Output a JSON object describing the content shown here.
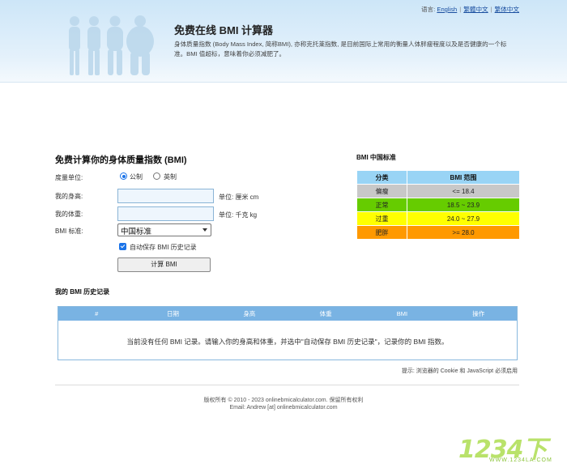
{
  "header": {
    "title": "免费在线 BMI 计算器",
    "description": "身体质量指数 (Body Mass Index, 简称BMI), 亦称克托莱指数, 是目前国际上常用的衡量人体胖瘦程度以及是否健康的一个标准。BMI 值超标，意味着你必须减肥了。",
    "lang_prefix": "语言:",
    "lang_options": [
      "English",
      "繁體中文",
      "繁体中文"
    ]
  },
  "form": {
    "title": "免费计算你的身体质量指数 (BMI)",
    "unit_label": "度量单位:",
    "unit_options": [
      "公制",
      "英制"
    ],
    "unit_selected": "公制",
    "height_label": "我的身高:",
    "height_value": "",
    "height_unit": "单位: 厘米 cm",
    "weight_label": "我的体重:",
    "weight_value": "",
    "weight_unit": "单位: 千克 kg",
    "standard_label": "BMI 标准:",
    "standard_selected": "中国标准",
    "autosave_label": "自动保存 BMI 历史记录",
    "autosave_checked": true,
    "submit_label": "计算 BMI"
  },
  "standard": {
    "title": "BMI 中国标准",
    "headers": [
      "分类",
      "BMI 范围"
    ],
    "rows": [
      {
        "category": "偏瘦",
        "range": "<= 18.4",
        "color": "#c8c8c8"
      },
      {
        "category": "正常",
        "range": "18.5 ~ 23.9",
        "color": "#66cc00"
      },
      {
        "category": "过重",
        "range": "24.0 ~ 27.9",
        "color": "#ffff00"
      },
      {
        "category": "肥胖",
        "range": ">= 28.0",
        "color": "#ff9900"
      }
    ]
  },
  "history": {
    "title": "我的 BMI 历史记录",
    "columns": [
      "#",
      "日期",
      "身高",
      "体重",
      "BMI",
      "操作"
    ],
    "empty_message": "当前没有任何 BMI 记录。请输入你的身高和体重，并选中\"自动保存 BMI 历史记录\"，记录你的 BMI 指数。"
  },
  "note": "提示: 浏览器的 Cookie 和 JavaScript 必须启用",
  "footer": {
    "copyright": "版权所有 © 2010 - 2023 onlinebmicalculator.com. 保留所有权利",
    "email": "Email: Andrew [at] onlinebmicalculator.com"
  },
  "watermark": {
    "text": "1234下",
    "sub": "WWW.1234LA.COM"
  },
  "colors": {
    "header_bg": "#cde6f8",
    "table_header": "#79b3e3",
    "link": "#1a4fa0"
  }
}
